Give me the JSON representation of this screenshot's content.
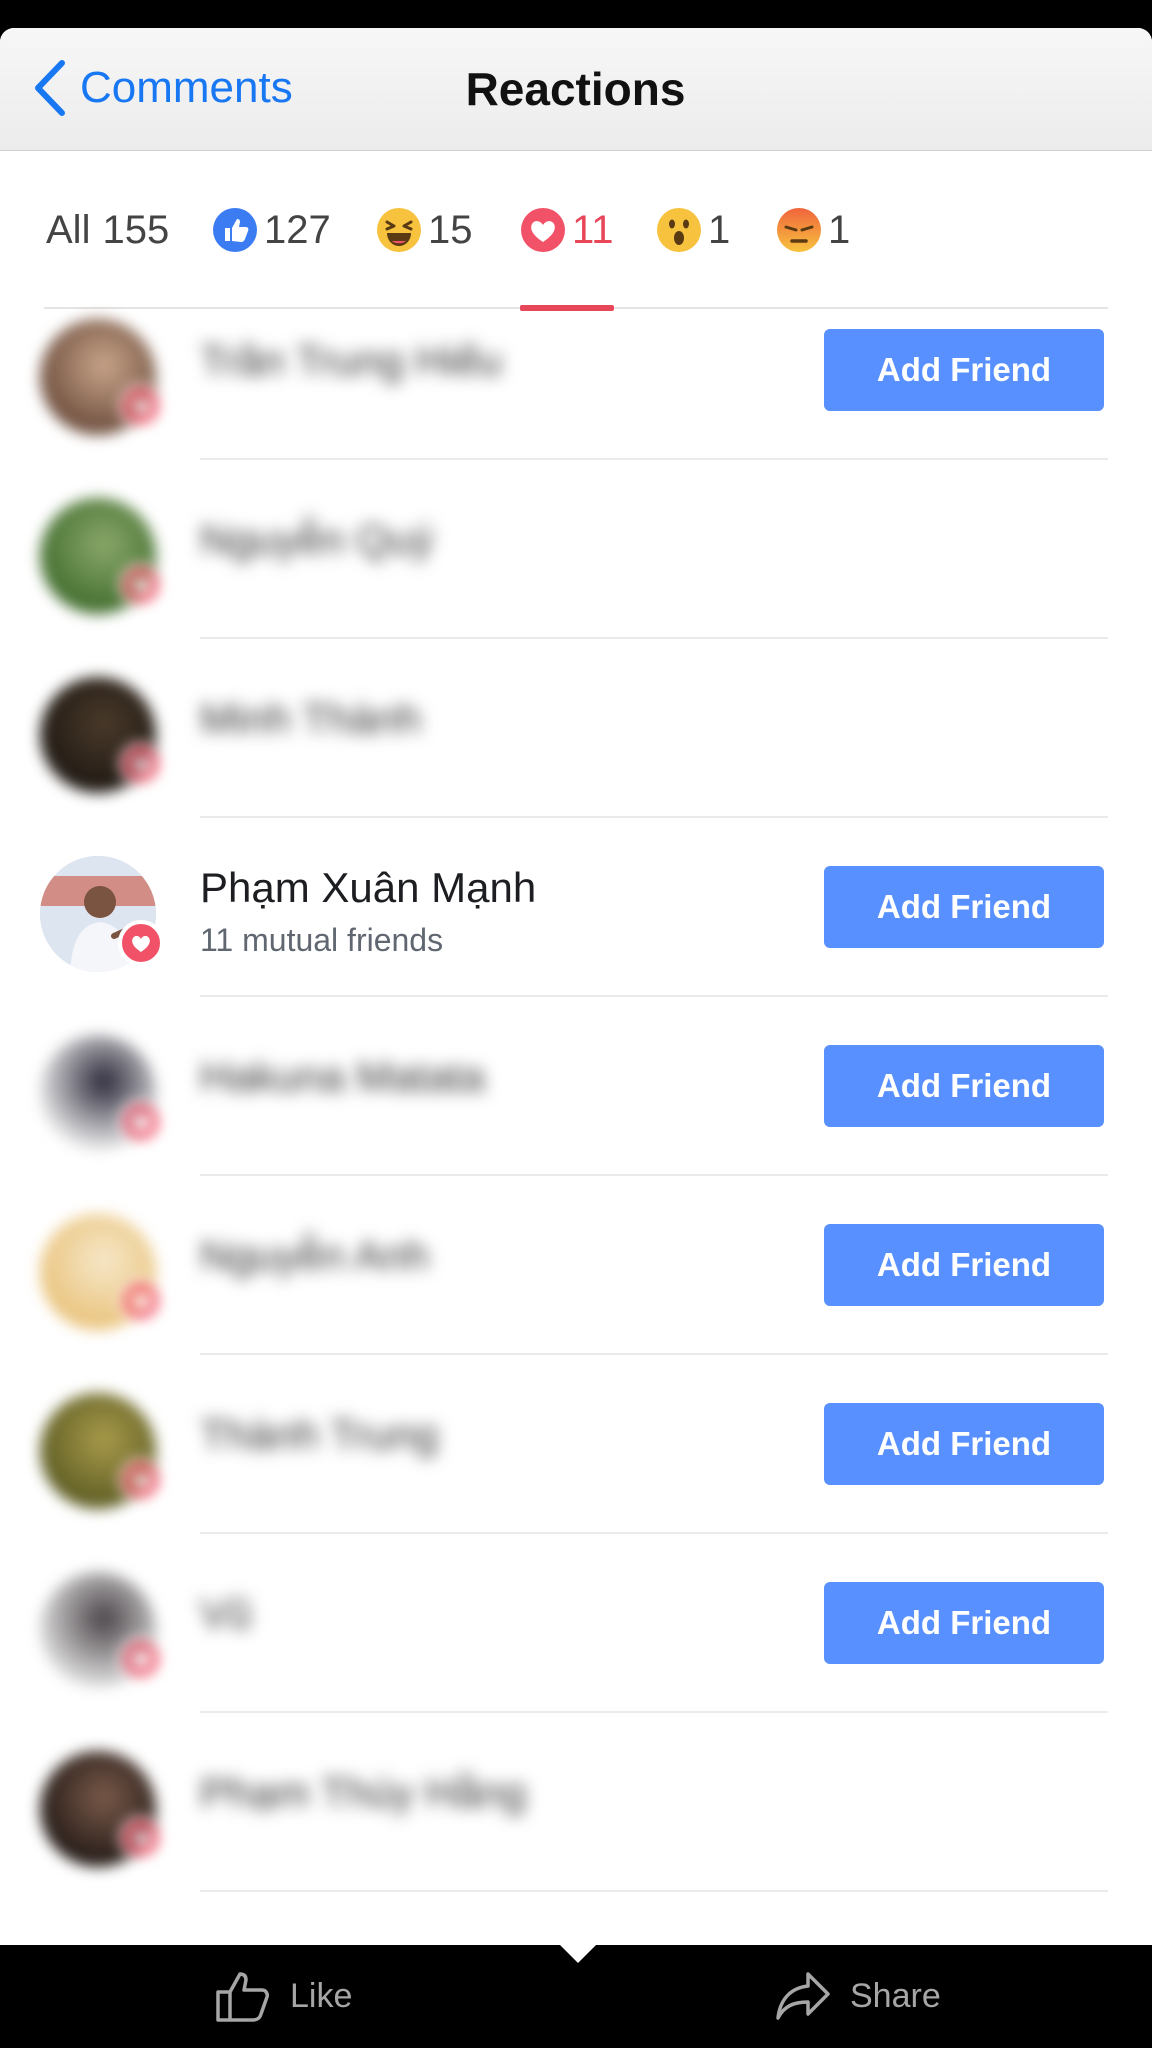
{
  "nav": {
    "back_label": "Comments",
    "title": "Reactions"
  },
  "tabs": [
    {
      "id": "all",
      "label": "All",
      "count": "155",
      "icon": null,
      "active": false
    },
    {
      "id": "like",
      "label": "",
      "count": "127",
      "icon": "like-icon",
      "active": false
    },
    {
      "id": "haha",
      "label": "",
      "count": "15",
      "icon": "haha-icon",
      "active": false
    },
    {
      "id": "love",
      "label": "",
      "count": "11",
      "icon": "love-icon",
      "active": true
    },
    {
      "id": "wow",
      "label": "",
      "count": "1",
      "icon": "wow-icon",
      "active": false
    },
    {
      "id": "angry",
      "label": "",
      "count": "1",
      "icon": "angry-icon",
      "active": false
    }
  ],
  "people": [
    {
      "name": "Trần Trung Hiếu",
      "mutual": "",
      "blurred": true,
      "add_friend": "Add Friend"
    },
    {
      "name": "Nguyễn Quý",
      "mutual": "",
      "blurred": true,
      "add_friend": ""
    },
    {
      "name": "Minh Thành",
      "mutual": "",
      "blurred": true,
      "add_friend": ""
    },
    {
      "name": "Phạm Xuân Mạnh",
      "mutual": "11 mutual friends",
      "blurred": false,
      "add_friend": "Add Friend"
    },
    {
      "name": "Hakuna Matata",
      "mutual": "",
      "blurred": true,
      "add_friend": "Add Friend"
    },
    {
      "name": "Nguyễn Anh",
      "mutual": "",
      "blurred": true,
      "add_friend": "Add Friend"
    },
    {
      "name": "Thành Trung",
      "mutual": "",
      "blurred": true,
      "add_friend": "Add Friend"
    },
    {
      "name": "Vũ",
      "mutual": "",
      "blurred": true,
      "add_friend": "Add Friend"
    },
    {
      "name": "Phạm Thúy Hằng",
      "mutual": "",
      "blurred": true,
      "add_friend": ""
    }
  ],
  "bottom_bar": {
    "like_label": "Like",
    "share_label": "Share"
  },
  "colors": {
    "accent_blue": "#1877f2",
    "button_blue": "#5890ff",
    "love_red": "#e8475a"
  }
}
